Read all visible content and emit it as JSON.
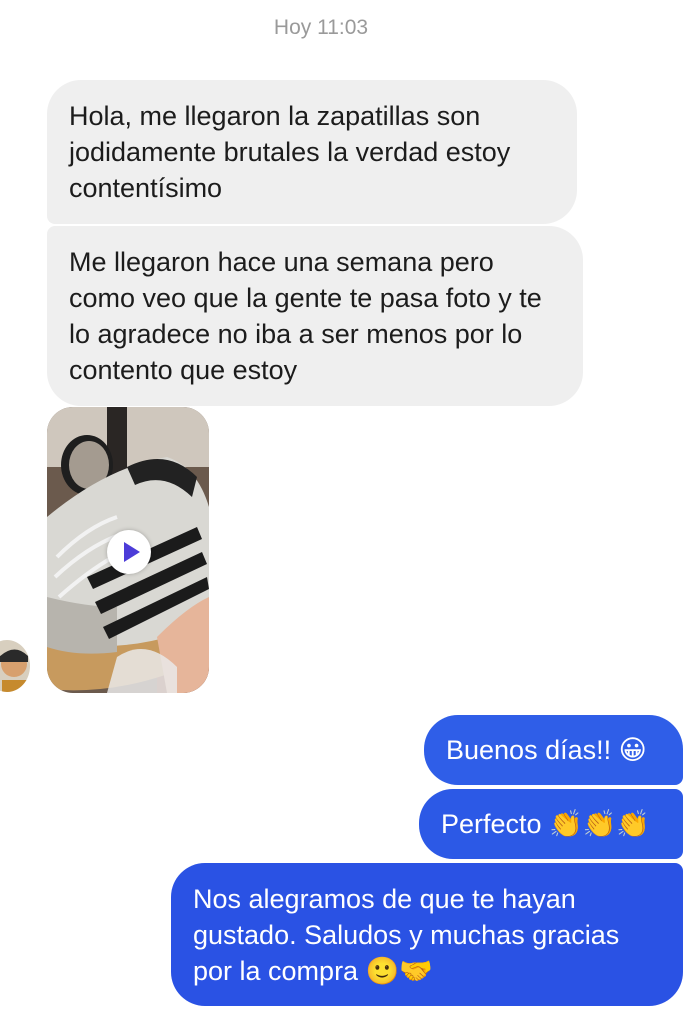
{
  "chat": {
    "timestamp": "Hoy 11:03",
    "incoming": [
      "Hola, me llegaron la zapatillas son jodidamente brutales la verdad estoy contentísimo",
      "Me llegaron hace una semana pero como veo que la gente te pasa foto y te lo agradece no iba a ser menos por lo contento que estoy"
    ],
    "outgoing": [
      {
        "text": "Buenos días!!",
        "emoji": "😀"
      },
      {
        "text": "Perfecto",
        "emoji": "👏👏👏"
      },
      {
        "text": "Nos alegramos de que te hayan gustado. Saludos y muchas gracias por la compra",
        "emoji": "🙂🤝"
      }
    ]
  },
  "icons": {
    "play": "play-icon",
    "avatar": "contact-avatar"
  },
  "colors": {
    "incoming_bubble": "#efefef",
    "outgoing_bubble": "#2f5ee8",
    "play_triangle": "#4c3cd8"
  }
}
